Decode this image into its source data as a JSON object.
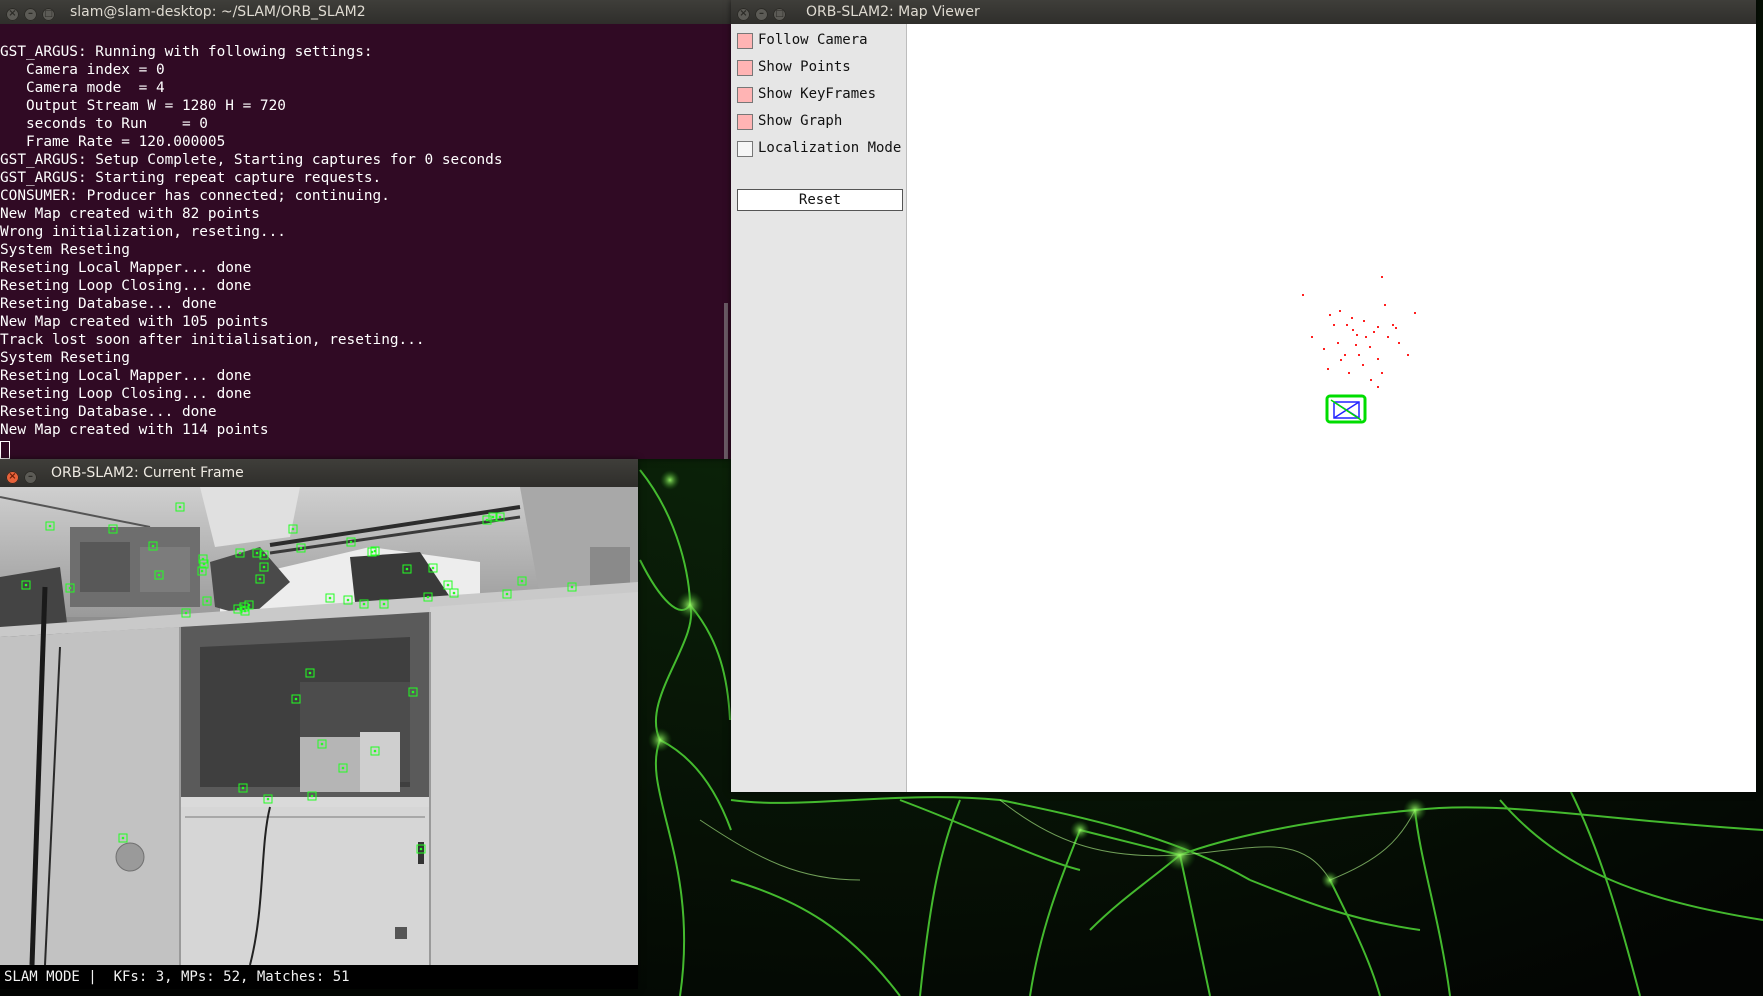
{
  "colors": {
    "terminal_bg": "#300a24",
    "keypoint": "#22ff22",
    "map_point": "#ff2020",
    "camera_frame": "#00dd00",
    "keyframe": "#2222ff",
    "checkbox_on": "#ffb4b4"
  },
  "terminal": {
    "title": "slam@slam-desktop: ~/SLAM/ORB_SLAM2",
    "lines": [
      "GST_ARGUS: Running with following settings:",
      "   Camera index = 0",
      "   Camera mode  = 4",
      "   Output Stream W = 1280 H = 720",
      "   seconds to Run    = 0",
      "   Frame Rate = 120.000005",
      "GST_ARGUS: Setup Complete, Starting captures for 0 seconds",
      "GST_ARGUS: Starting repeat capture requests.",
      "CONSUMER: Producer has connected; continuing.",
      "New Map created with 82 points",
      "Wrong initialization, reseting...",
      "System Reseting",
      "Reseting Local Mapper... done",
      "Reseting Loop Closing... done",
      "Reseting Database... done",
      "New Map created with 105 points",
      "Track lost soon after initialisation, reseting...",
      "System Reseting",
      "Reseting Local Mapper... done",
      "Reseting Loop Closing... done",
      "Reseting Database... done",
      "New Map created with 114 points"
    ]
  },
  "map_viewer": {
    "title": "ORB-SLAM2: Map Viewer",
    "options": [
      {
        "label": "Follow Camera",
        "checked": true
      },
      {
        "label": "Show Points",
        "checked": true
      },
      {
        "label": "Show KeyFrames",
        "checked": true
      },
      {
        "label": "Show Graph",
        "checked": true
      },
      {
        "label": "Localization Mode",
        "checked": false
      }
    ],
    "reset_label": "Reset"
  },
  "current_frame": {
    "title": "ORB-SLAM2: Current Frame",
    "status": "SLAM MODE |  KFs: 3, MPs: 52, Matches: 51"
  }
}
